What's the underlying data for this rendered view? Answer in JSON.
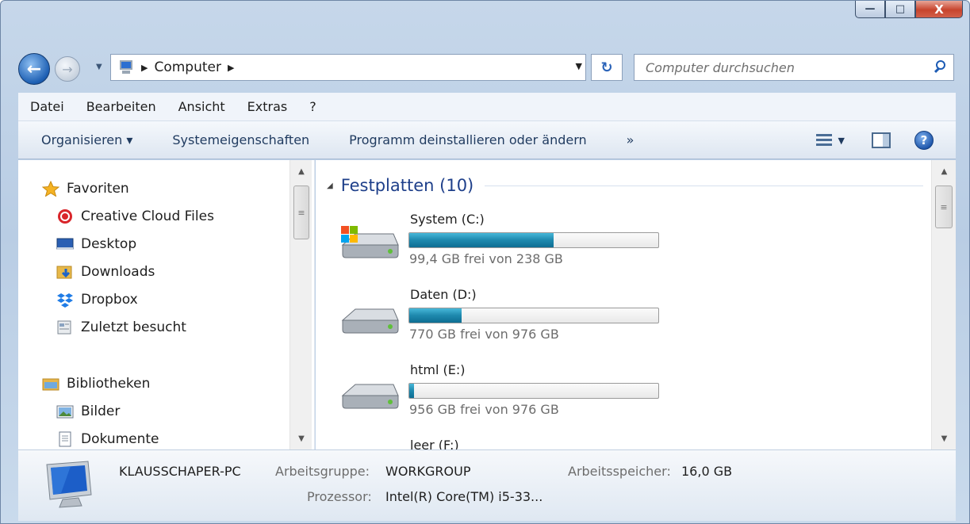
{
  "window": {
    "caption": {
      "minimize": "—",
      "maximize": "□",
      "close": "X"
    }
  },
  "address_bar": {
    "location": "Computer",
    "back": "←",
    "forward": "→",
    "refresh": "↻"
  },
  "search": {
    "placeholder": "Computer durchsuchen"
  },
  "menubar": {
    "items": [
      "Datei",
      "Bearbeiten",
      "Ansicht",
      "Extras",
      "?"
    ]
  },
  "toolbar": {
    "organize": "Organisieren ▾",
    "system_properties": "Systemeigenschaften",
    "uninstall": "Programm deinstallieren oder ändern",
    "more": "»",
    "view_dropdown": "▼",
    "help": "?"
  },
  "nav_pane": {
    "favorites": {
      "label": "Favoriten",
      "items": [
        "Creative Cloud Files",
        "Desktop",
        "Downloads",
        "Dropbox",
        "Zuletzt besucht"
      ]
    },
    "libraries": {
      "label": "Bibliotheken",
      "items": [
        "Bilder",
        "Dokumente"
      ]
    }
  },
  "content": {
    "group_title": "Festplatten (10)",
    "drives": [
      {
        "name": "System (C:)",
        "free": "99,4 GB frei von 238 GB",
        "used_fraction": 0.58,
        "icon": "windows-drive-icon"
      },
      {
        "name": "Daten (D:)",
        "free": "770 GB frei von 976 GB",
        "used_fraction": 0.21,
        "icon": "hard-drive-icon"
      },
      {
        "name": "html (E:)",
        "free": "956 GB frei von 976 GB",
        "used_fraction": 0.02,
        "icon": "hard-drive-icon"
      },
      {
        "name": "leer (F:)"
      }
    ]
  },
  "details": {
    "computer_name": "KLAUSSCHAPER-PC",
    "workgroup_label": "Arbeitsgruppe:",
    "workgroup_value": "WORKGROUP",
    "memory_label": "Arbeitsspeicher:",
    "memory_value": "16,0 GB",
    "processor_label": "Prozessor:",
    "processor_value": "Intel(R) Core(TM) i5-33..."
  },
  "colors": {
    "accent": "#1e3f8a",
    "bar_fill": "#1e88ad",
    "close_button": "#c7442d"
  }
}
